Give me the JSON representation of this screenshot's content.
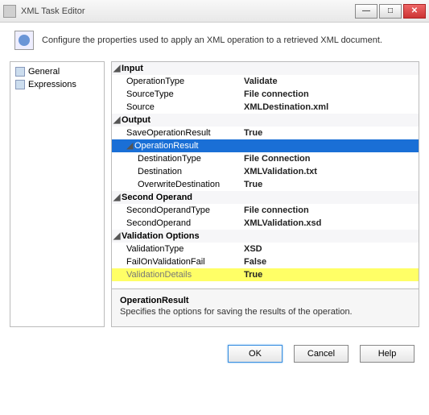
{
  "window": {
    "title": "XML Task Editor"
  },
  "description": "Configure the properties used to apply an XML operation to a retrieved XML document.",
  "nav": [
    {
      "label": "General"
    },
    {
      "label": "Expressions"
    }
  ],
  "categories": [
    {
      "name": "Input",
      "props": [
        {
          "name": "OperationType",
          "value": "Validate"
        },
        {
          "name": "SourceType",
          "value": "File connection"
        },
        {
          "name": "Source",
          "value": "XMLDestination.xml"
        }
      ]
    },
    {
      "name": "Output",
      "props": [
        {
          "name": "SaveOperationResult",
          "value": "True"
        },
        {
          "name": "OperationResult",
          "value": "",
          "selected": true,
          "children": [
            {
              "name": "DestinationType",
              "value": "File Connection"
            },
            {
              "name": "Destination",
              "value": "XMLValidation.txt"
            },
            {
              "name": "OverwriteDestination",
              "value": "True"
            }
          ]
        }
      ]
    },
    {
      "name": "Second Operand",
      "props": [
        {
          "name": "SecondOperandType",
          "value": "File connection"
        },
        {
          "name": "SecondOperand",
          "value": "XMLValidation.xsd"
        }
      ]
    },
    {
      "name": "Validation Options",
      "props": [
        {
          "name": "ValidationType",
          "value": "XSD"
        },
        {
          "name": "FailOnValidationFail",
          "value": "False"
        },
        {
          "name": "ValidationDetails",
          "value": "True",
          "highlight": true
        }
      ]
    }
  ],
  "info": {
    "title": "OperationResult",
    "desc": "Specifies the options for saving the results of the operation."
  },
  "buttons": {
    "ok": "OK",
    "cancel": "Cancel",
    "help": "Help"
  }
}
